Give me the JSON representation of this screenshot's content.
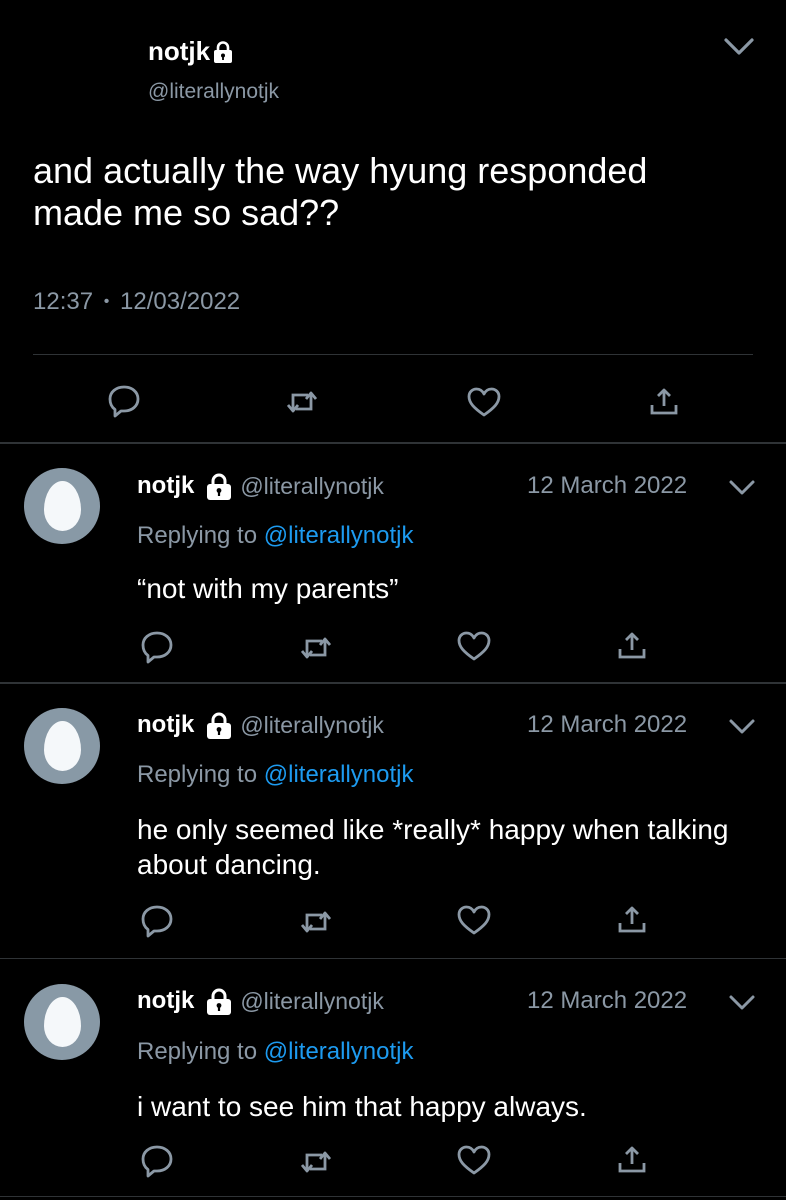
{
  "main_tweet": {
    "name": "notjk",
    "handle": "@literallynotjk",
    "text": "and actually the way hyung responded made me so sad??",
    "time": "12:37",
    "separator": "•",
    "date": "12/03/2022"
  },
  "replies": [
    {
      "name": "notjk",
      "handle": "@literallynotjk",
      "date": "12 March 2022",
      "replying_prefix": "Replying to ",
      "replying_to": "@literallynotjk",
      "text": "“not with my parents”"
    },
    {
      "name": "notjk",
      "handle": "@literallynotjk",
      "date": "12 March 2022",
      "replying_prefix": "Replying to ",
      "replying_to": "@literallynotjk",
      "text": "he only seemed like *really* happy when talking about dancing."
    },
    {
      "name": "notjk",
      "handle": "@literallynotjk",
      "date": "12 March 2022",
      "replying_prefix": "Replying to ",
      "replying_to": "@literallynotjk",
      "text": "i want to see him that happy always."
    }
  ],
  "icons": [
    "lock-icon",
    "chevron-down-icon",
    "reply-icon",
    "retweet-icon",
    "like-icon",
    "share-icon"
  ],
  "colors": {
    "background": "#000000",
    "text": "#ffffff",
    "muted": "#8b98a5",
    "link": "#1d9bf0",
    "separator": "#2f3336",
    "avatar": "#8899a6"
  }
}
